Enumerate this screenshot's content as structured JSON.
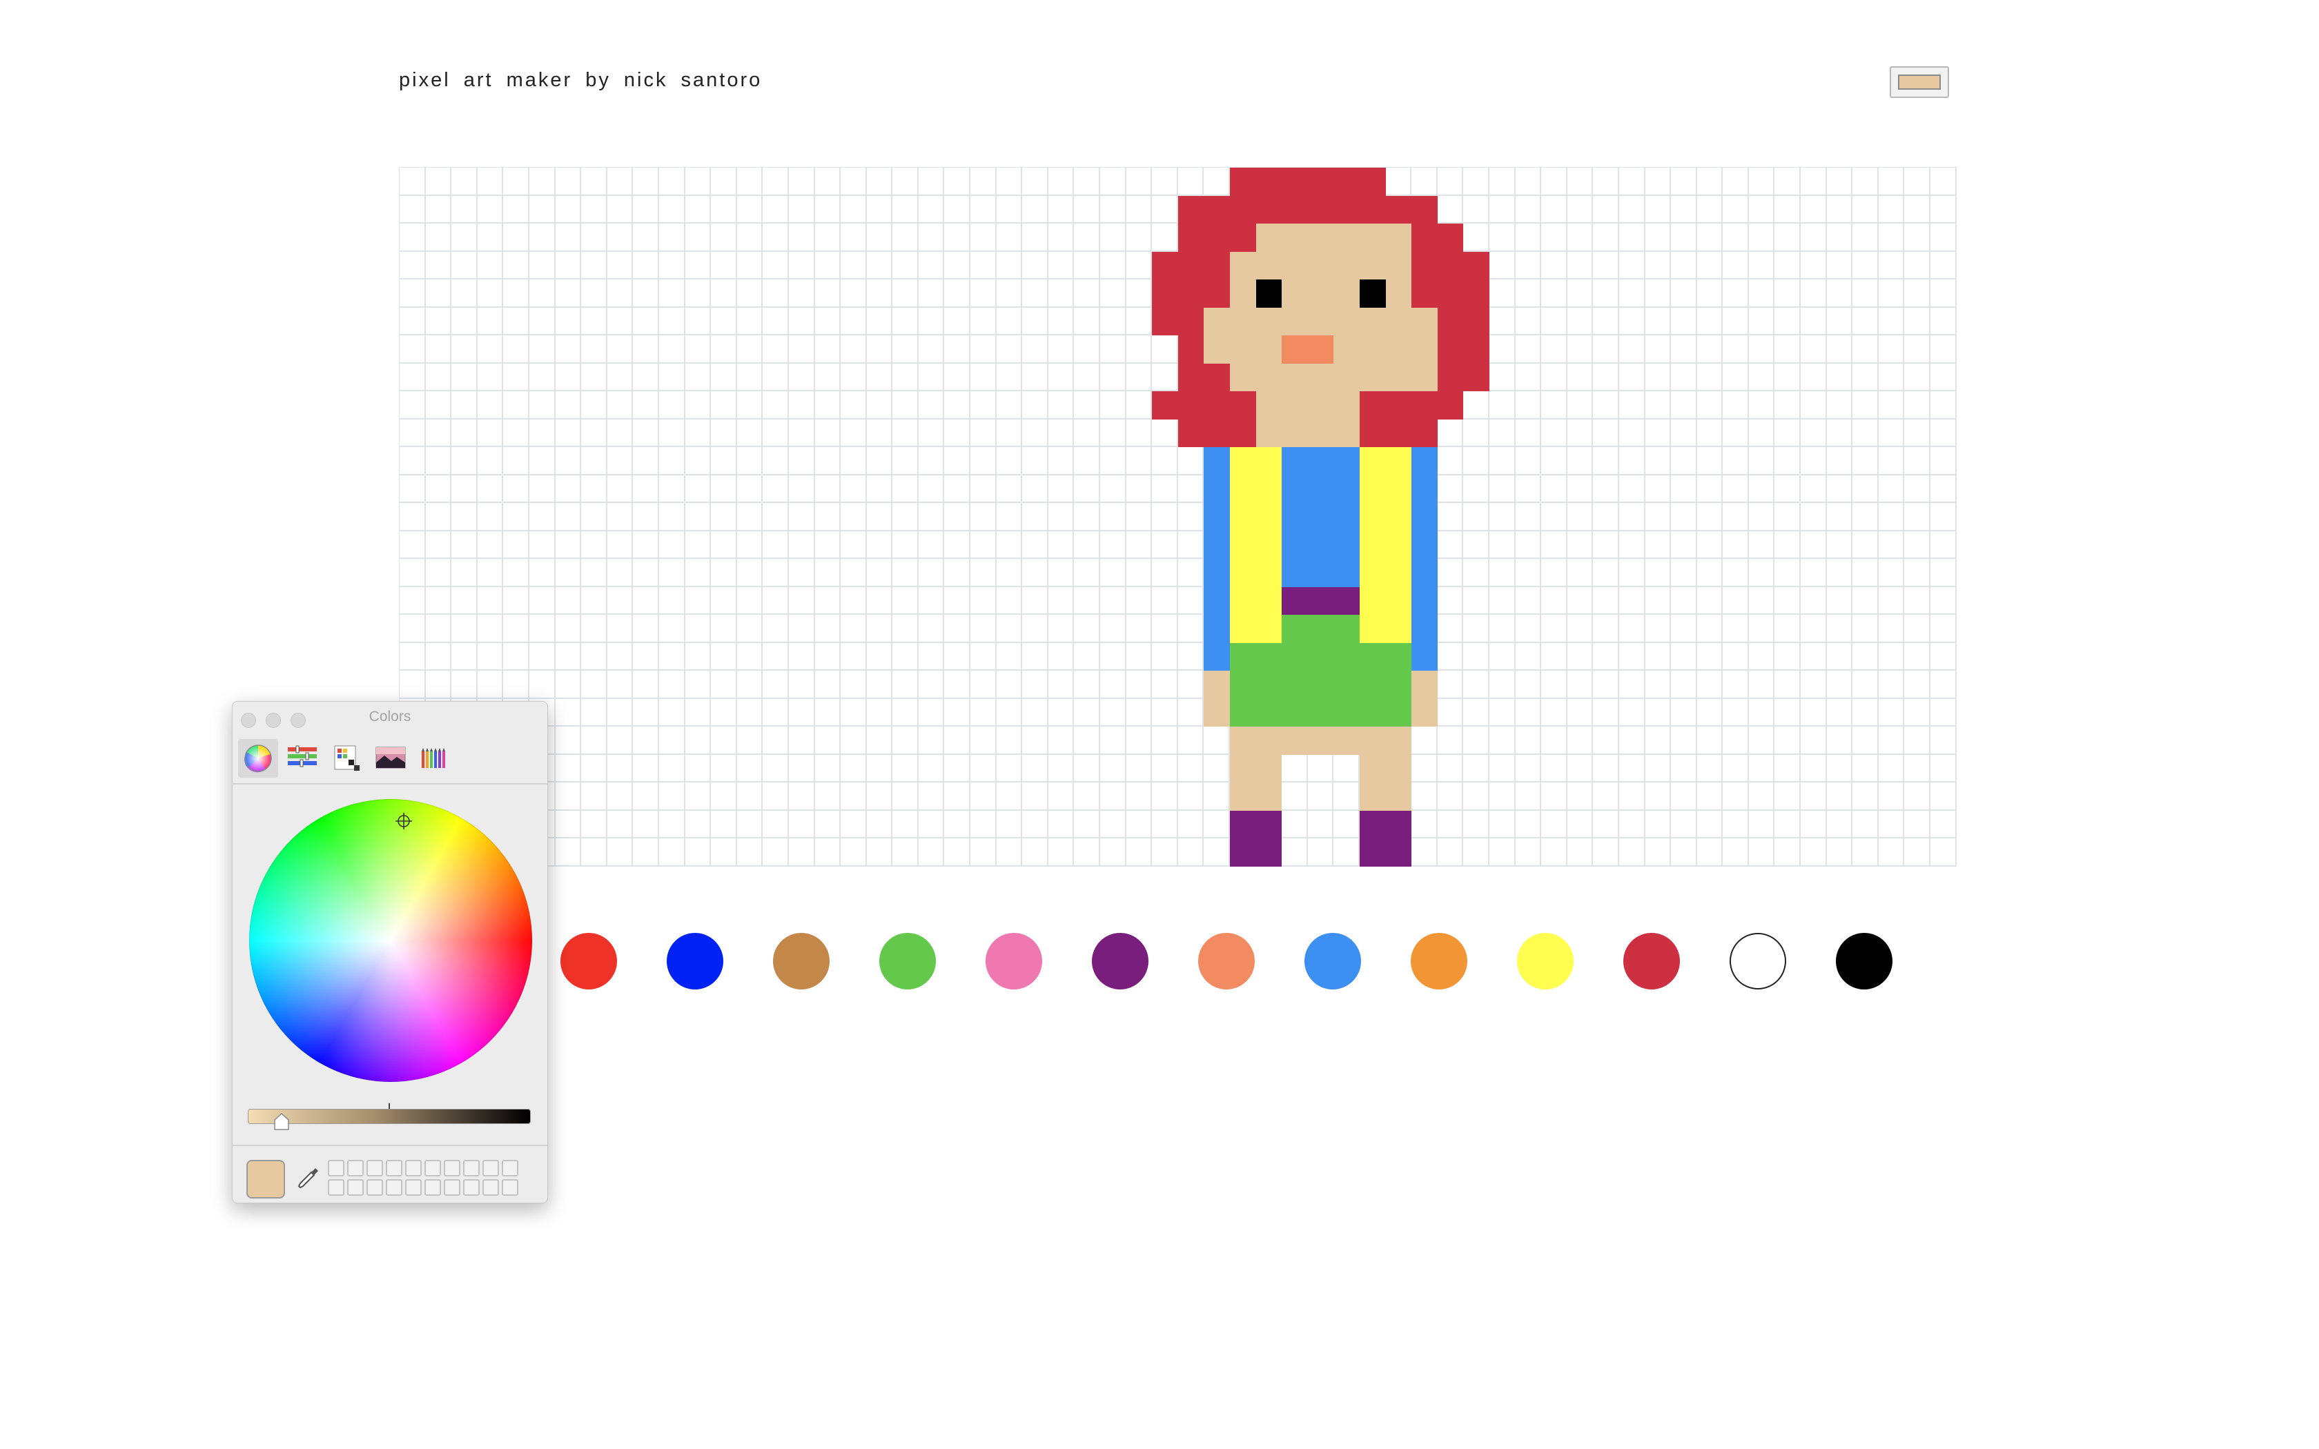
{
  "page": {
    "title": "pixel art maker by nick santoro",
    "selected_color": "#e6c9a0"
  },
  "grid": {
    "columns": 60,
    "rows": 25,
    "line_color": "#dfe3e6",
    "palette": {
      "H": "#cd3040",
      "S": "#e6c9a0",
      "E": "#000000",
      "N": "#f28b62",
      "B": "#3d8ff2",
      "Y": "#fffe50",
      "P": "#7a1e7e",
      "G": "#63c84c"
    },
    "pixels": [
      "................................HHHHHH......................",
      "..............................HHHHHHHHHH....................",
      "..............................HHHSSSSSSHH...................",
      ".............................HHHSSSSSSSHHH..................",
      ".............................HHHSESSSESHHH..................",
      ".............................HHSSSSSSSSSHH..................",
      "..............................HSSSNNSSSSHH..................",
      "..............................HHSSSSSSSSHH..................",
      ".............................HHHHSSSSHHHH...................",
      "..............................HHHSSSSHHH....................",
      "...............................BYYBBBYYB....................",
      "...............................BYYBBBYYB....................",
      "...............................BYYBBBYYB....................",
      "...............................BYYBBBYYB....................",
      "...............................BYYBBBYYB....................",
      "...............................BYYPPPYYB....................",
      "...............................BYYGGGYYB....................",
      "...............................BGGGGGGGB....................",
      "...............................SGGGGGGGS....................",
      "...............................SGGGGGGGS....................",
      "................................SSSSSSS.....................",
      "................................SS...SS.....................",
      "................................SS...SS.....................",
      "................................PP...PP.....................",
      "................................PP...PP....................."
    ]
  },
  "color_palette": [
    {
      "name": "red",
      "color": "#ee3227"
    },
    {
      "name": "blue",
      "color": "#0022f5"
    },
    {
      "name": "brown",
      "color": "#c4874a"
    },
    {
      "name": "green",
      "color": "#63c84c"
    },
    {
      "name": "pink",
      "color": "#ef78b1"
    },
    {
      "name": "purple",
      "color": "#7a1e7e"
    },
    {
      "name": "salmon",
      "color": "#f28b62"
    },
    {
      "name": "light-blue",
      "color": "#3d8ff2"
    },
    {
      "name": "orange",
      "color": "#f19535"
    },
    {
      "name": "yellow",
      "color": "#fffe50"
    },
    {
      "name": "crimson",
      "color": "#cd3040"
    },
    {
      "name": "white",
      "color": "#ffffff"
    },
    {
      "name": "black",
      "color": "#000000"
    }
  ],
  "colors_panel": {
    "title": "Colors",
    "tabs": [
      "color-wheel-icon",
      "color-sliders-icon",
      "color-palettes-icon",
      "image-palettes-icon",
      "crayons-icon"
    ],
    "active_tab": 0,
    "current_color": "#e6c9a0",
    "brightness_fraction": 0.12,
    "swatch_slots": 20
  }
}
